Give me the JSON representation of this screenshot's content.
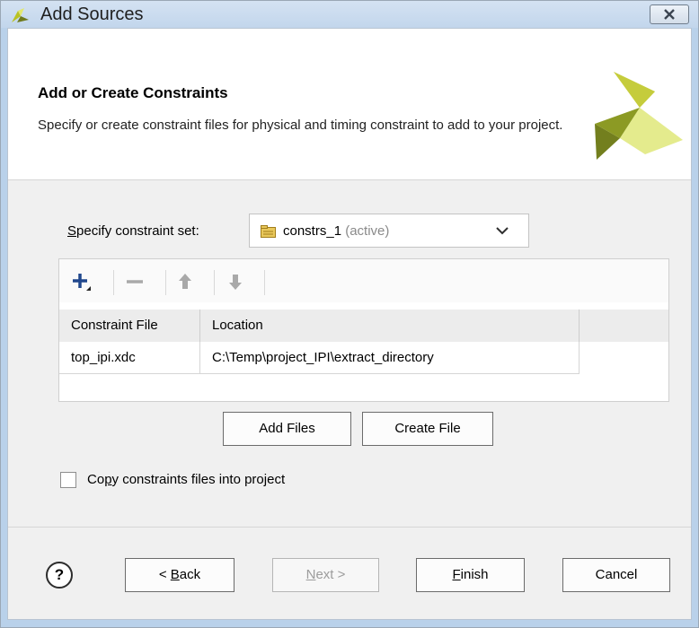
{
  "window": {
    "title": "Add Sources"
  },
  "header": {
    "title": "Add or Create Constraints",
    "description": "Specify or create constraint files for physical and timing constraint to add to your project."
  },
  "constraint_set": {
    "label_prefix": "S",
    "label_rest": "pecify constraint set:",
    "name": "constrs_1",
    "status": "(active)"
  },
  "toolbar": {
    "icons": [
      "add-icon",
      "remove-icon",
      "move-up-icon",
      "move-down-icon"
    ]
  },
  "table": {
    "columns": [
      "Constraint File",
      "Location"
    ],
    "rows": [
      {
        "file": "top_ipi.xdc",
        "location": "C:\\Temp\\project_IPI\\extract_directory"
      }
    ]
  },
  "actions": {
    "add_files": "Add Files",
    "create_file": "Create File"
  },
  "copy_option": {
    "label_prefix": "Co",
    "label_key": "p",
    "label_rest": "y constraints files into project",
    "checked": false
  },
  "footer": {
    "help": "?",
    "back_prefix": "< ",
    "back_key": "B",
    "back_rest": "ack",
    "next_key": "N",
    "next_rest": "ext >",
    "finish_key": "F",
    "finish_rest": "inish",
    "cancel": "Cancel"
  },
  "colors": {
    "logo_light": "#e4eb8d",
    "logo_mid": "#c5cc3c",
    "logo_dark": "#737f1e",
    "plus_icon": "#20478d"
  }
}
